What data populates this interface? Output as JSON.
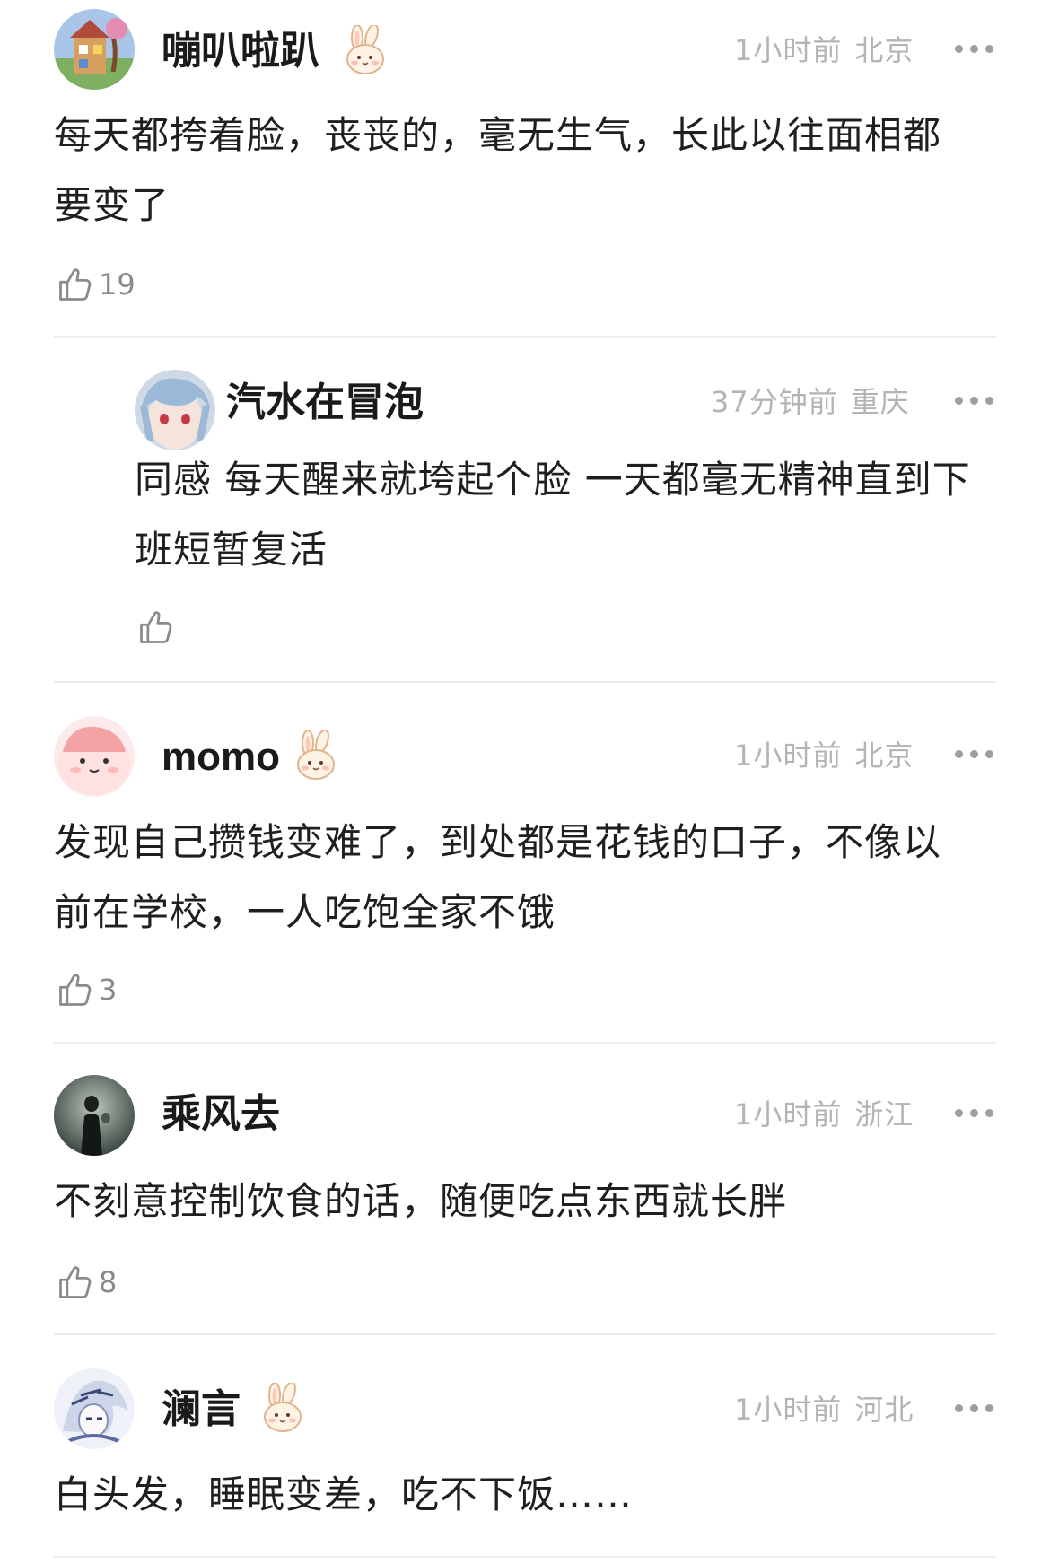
{
  "comments": [
    {
      "author": "嘣叭啦趴",
      "time": "1小时前",
      "location": "北京",
      "text": "每天都挎着脸，丧丧的，毫无生气，长此以往面相都要变了",
      "likes": "19",
      "badge": "bunny-badge-icon",
      "reply": {
        "author": "汽水在冒泡",
        "time": "37分钟前",
        "location": "重庆",
        "text": "同感  每天醒来就垮起个脸  一天都毫无精神直到下班短暂复活",
        "likes": ""
      }
    },
    {
      "author": "momo",
      "time": "1小时前",
      "location": "北京",
      "text": "发现自己攒钱变难了，到处都是花钱的口子，不像以前在学校，一人吃饱全家不饿",
      "likes": "3",
      "badge": "bunny-badge-icon"
    },
    {
      "author": "乘风去",
      "time": "1小时前",
      "location": "浙江",
      "text": "不刻意控制饮食的话，随便吃点东西就长胖",
      "likes": "8"
    },
    {
      "author": "澜言",
      "time": "1小时前",
      "location": "河北",
      "text": "白头发，睡眠变差，吃不下饭……",
      "badge": "bunny-badge-icon"
    }
  ],
  "colors": {
    "meta_text": "#b4b4b4",
    "divider": "#ececec",
    "like_icon": "#8a8a8a"
  }
}
